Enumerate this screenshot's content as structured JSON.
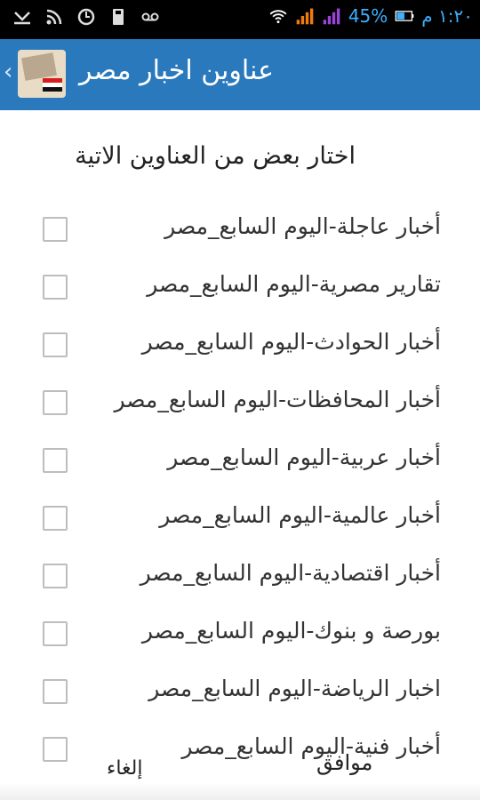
{
  "status_bar": {
    "battery_percent": "45%",
    "time": "١:٢٠ م",
    "icons": [
      "missed-call-icon",
      "rss-icon",
      "sync-icon",
      "sd-card-icon",
      "voicemail-icon",
      "wifi-icon",
      "signal-orange-icon",
      "signal-purple-icon",
      "battery-icon"
    ]
  },
  "action_bar": {
    "title": "عناوين اخبار مصر",
    "icon": "app-logo-egypt-news"
  },
  "dialog": {
    "heading": "اختار بعض من العناوين الاتية",
    "items": [
      {
        "label": "أخبار عاجلة-اليوم السابع_مصر",
        "checked": false
      },
      {
        "label": "تقارير مصرية-اليوم السابع_مصر",
        "checked": false
      },
      {
        "label": "أخبار الحوادث-اليوم السابع_مصر",
        "checked": false
      },
      {
        "label": "أخبار المحافظات-اليوم السابع_مصر",
        "checked": false
      },
      {
        "label": "أخبار عربية-اليوم السابع_مصر",
        "checked": false
      },
      {
        "label": "أخبار عالمية-اليوم السابع_مصر",
        "checked": false
      },
      {
        "label": "أخبار اقتصادية-اليوم السابع_مصر",
        "checked": false
      },
      {
        "label": "بورصة و بنوك-اليوم السابع_مصر",
        "checked": false
      },
      {
        "label": "اخبار الرياضة-اليوم السابع_مصر",
        "checked": false
      },
      {
        "label": "أخبار فنية-اليوم السابع_مصر",
        "checked": false
      }
    ],
    "ok_label": "موافق",
    "cancel_label": "إلغاء"
  },
  "colors": {
    "action_bar": "#2a79bd",
    "status_bar": "#000000",
    "status_text": "#3ab0ff"
  }
}
